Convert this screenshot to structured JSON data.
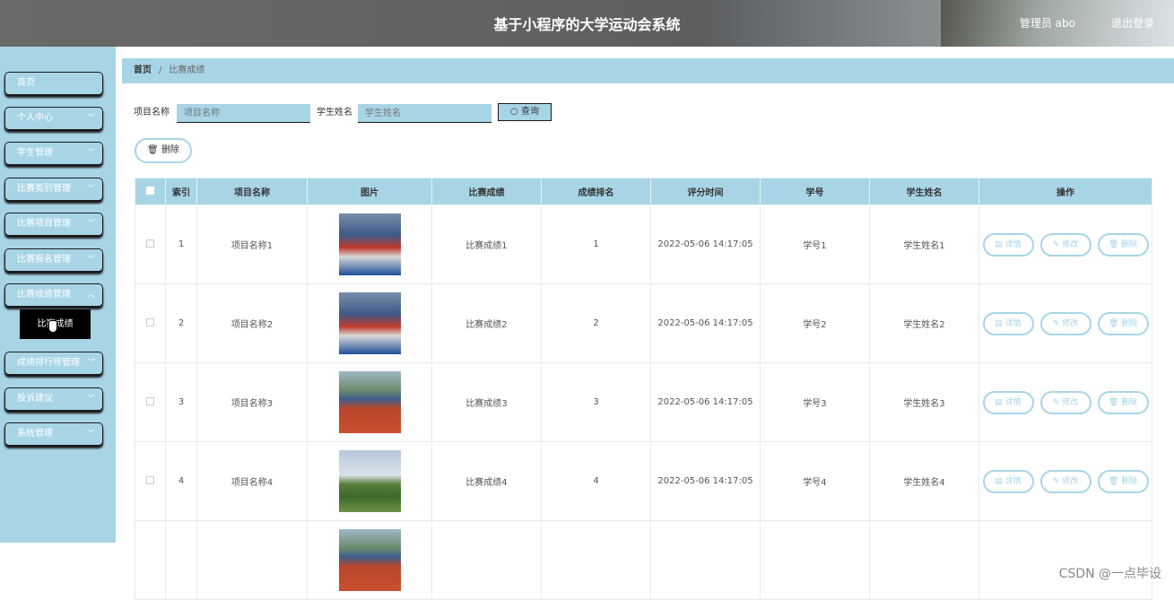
{
  "header": {
    "title": "基于小程序的大学运动会系统",
    "admin": "管理员 abo",
    "logout": "退出登录"
  },
  "sidebar": {
    "items": [
      {
        "label": "首页",
        "has_chevron": false
      },
      {
        "label": "个人中心",
        "has_chevron": true
      },
      {
        "label": "学生管理",
        "has_chevron": true
      },
      {
        "label": "比赛类别管理",
        "has_chevron": true
      },
      {
        "label": "比赛项目管理",
        "has_chevron": true
      },
      {
        "label": "比赛报名管理",
        "has_chevron": true
      },
      {
        "label": "比赛成绩管理",
        "has_chevron": true
      },
      {
        "label": "成绩排行榜管理",
        "has_chevron": true
      },
      {
        "label": "投诉建议",
        "has_chevron": true
      },
      {
        "label": "系统管理",
        "has_chevron": true
      }
    ],
    "submenu": {
      "label": "比赛成绩"
    }
  },
  "breadcrumb": {
    "home": "首页",
    "current": "比赛成绩"
  },
  "search": {
    "project_label": "项目名称",
    "project_placeholder": "项目名称",
    "student_label": "学生姓名",
    "student_placeholder": "学生姓名",
    "query_label": "查询"
  },
  "delete_label": "删除",
  "table": {
    "headers": [
      "",
      "索引",
      "项目名称",
      "图片",
      "比赛成绩",
      "成绩排名",
      "评分时间",
      "学号",
      "学生姓名",
      "操作"
    ],
    "rows": [
      {
        "index": "1",
        "project": "项目名称1",
        "image": "t1",
        "score": "比赛成绩1",
        "rank": "1",
        "time": "2022-05-06 14:17:05",
        "sid": "学号1",
        "name": "学生姓名1"
      },
      {
        "index": "2",
        "project": "项目名称2",
        "image": "t1",
        "score": "比赛成绩2",
        "rank": "2",
        "time": "2022-05-06 14:17:05",
        "sid": "学号2",
        "name": "学生姓名2"
      },
      {
        "index": "3",
        "project": "项目名称3",
        "image": "t3",
        "score": "比赛成绩3",
        "rank": "3",
        "time": "2022-05-06 14:17:05",
        "sid": "学号3",
        "name": "学生姓名3"
      },
      {
        "index": "4",
        "project": "项目名称4",
        "image": "t4",
        "score": "比赛成绩4",
        "rank": "4",
        "time": "2022-05-06 14:17:05",
        "sid": "学号4",
        "name": "学生姓名4"
      }
    ],
    "ops": {
      "detail": "详情",
      "edit": "修改",
      "delete": "删除"
    }
  },
  "watermark": "CSDN @一点毕设"
}
